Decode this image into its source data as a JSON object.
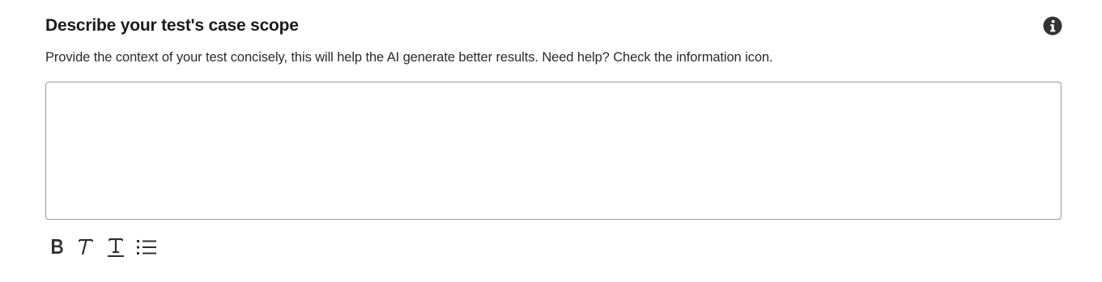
{
  "section": {
    "title": "Describe your test's case scope",
    "description": "Provide the context of your test concisely, this will help the AI generate better results. Need help? Check the information icon.",
    "info_icon": "info-circle-icon"
  },
  "editor": {
    "value": "",
    "placeholder": ""
  },
  "toolbar": {
    "items": [
      {
        "name": "bold",
        "icon": "bold-icon"
      },
      {
        "name": "italic",
        "icon": "italic-icon"
      },
      {
        "name": "underline",
        "icon": "underline-icon"
      },
      {
        "name": "bulleted-list",
        "icon": "list-icon"
      }
    ]
  },
  "colors": {
    "text": "#1b1b1b",
    "icon": "#2f2f2f",
    "border": "#9a9a9a",
    "info_icon": "#333333"
  }
}
